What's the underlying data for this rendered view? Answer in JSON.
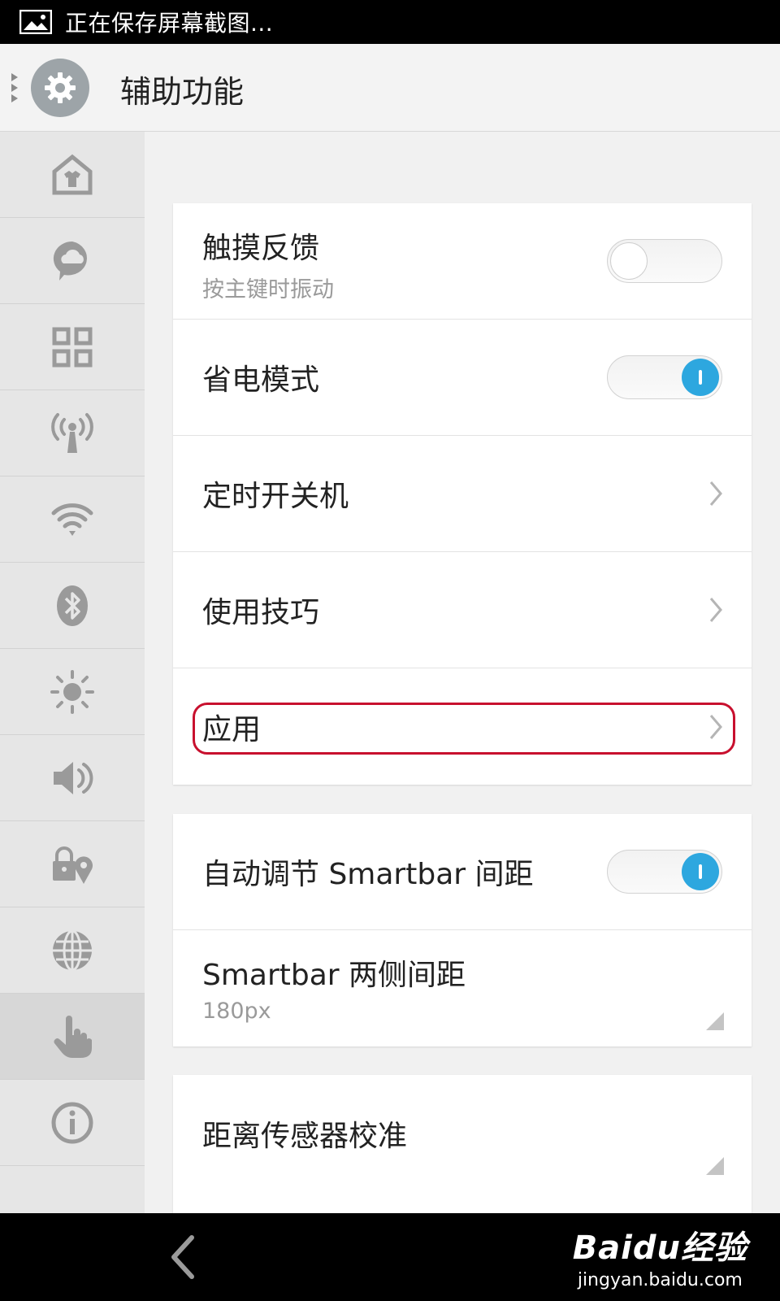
{
  "status_bar": {
    "text": "正在保存屏幕截图..."
  },
  "header": {
    "title": "辅助功能"
  },
  "sidebar": {
    "items": [
      {
        "icon": "home-shirt-icon"
      },
      {
        "icon": "cloud-chat-icon"
      },
      {
        "icon": "grid-apps-icon"
      },
      {
        "icon": "antenna-icon"
      },
      {
        "icon": "wifi-icon"
      },
      {
        "icon": "bluetooth-icon"
      },
      {
        "icon": "brightness-icon"
      },
      {
        "icon": "volume-icon"
      },
      {
        "icon": "lock-location-icon"
      },
      {
        "icon": "globe-icon"
      },
      {
        "icon": "hand-pointer-icon",
        "active": true
      },
      {
        "icon": "info-icon"
      }
    ]
  },
  "settings": {
    "group1": {
      "haptic": {
        "label": "触摸反馈",
        "sub": "按主键时振动",
        "toggle": "off"
      },
      "power_saving": {
        "label": "省电模式",
        "toggle": "on"
      },
      "scheduled_power": {
        "label": "定时开关机"
      },
      "tips": {
        "label": "使用技巧"
      },
      "apps": {
        "label": "应用"
      }
    },
    "group2": {
      "smartbar_auto": {
        "label": "自动调节 Smartbar 间距",
        "toggle": "on"
      },
      "smartbar_side": {
        "label": "Smartbar 两侧间距",
        "sub": "180px"
      }
    },
    "group3": {
      "proximity": {
        "label": "距离传感器校准"
      }
    }
  },
  "watermark": {
    "logo": "Baidu经验",
    "url": "jingyan.baidu.com"
  },
  "colors": {
    "accent": "#2da7df",
    "highlight": "#c8102e"
  }
}
